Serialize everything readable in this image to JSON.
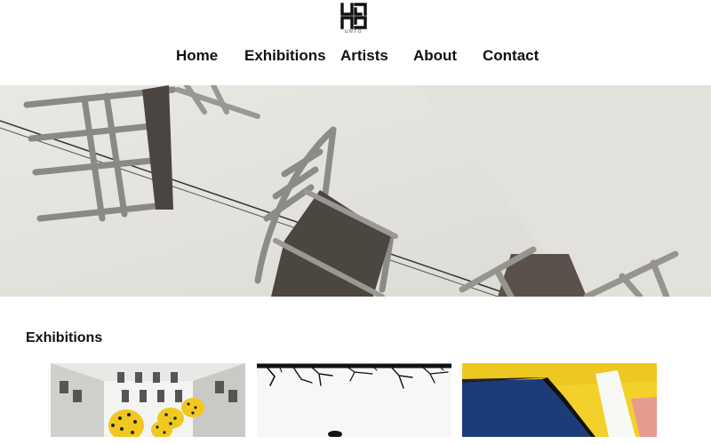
{
  "brand": {
    "logo_text": "UNTO",
    "logo_icon": "unto-logo-icon"
  },
  "nav": {
    "items": [
      {
        "label": "Home"
      },
      {
        "label": "Exhibitions"
      },
      {
        "label": "Artists"
      },
      {
        "label": "About"
      },
      {
        "label": "Contact"
      }
    ]
  },
  "hero": {
    "image": "suspended-chairs-installation-photo"
  },
  "exhibitions": {
    "title": "Exhibitions",
    "cards": [
      {
        "image": "yellow-polka-dot-sculptures-courtyard-photo"
      },
      {
        "image": "bare-tree-silhouette-photo"
      },
      {
        "image": "yellow-blue-abstract-mural-photo"
      }
    ]
  },
  "colors": {
    "background": "#ffffff",
    "text": "#111111",
    "mural_yellow": "#f1d12a",
    "mural_blue": "#1c3b7a"
  }
}
